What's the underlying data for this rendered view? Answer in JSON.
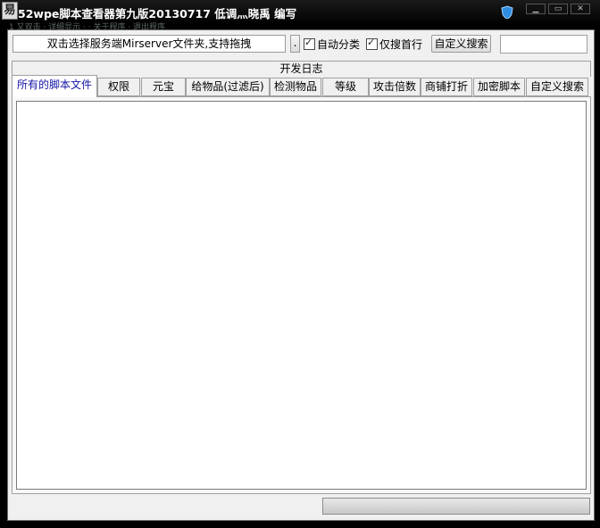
{
  "window": {
    "title": "52wpe脚本查看器第九版20130717  低调灬晓禹 编写",
    "app_icon_glyph": "易",
    "background_menu_text": "1 又双击 · 详细显示 · · 关于程序 · 退出程序"
  },
  "toolbar": {
    "path_button_label": "双击选择服务端Mirserver文件夹,支持拖拽",
    "dot_button_label": ".",
    "auto_classify_label": "自动分类",
    "auto_classify_checked": true,
    "first_line_only_label": "仅搜首行",
    "first_line_only_checked": true,
    "custom_search_button_label": "自定义搜索",
    "search_value": ""
  },
  "tabs_row1": {
    "label": "开发日志"
  },
  "tabs_row2": [
    {
      "label": "所有的脚本文件",
      "active": true
    },
    {
      "label": "权限"
    },
    {
      "label": "元宝"
    },
    {
      "label": "给物品(过滤后)"
    },
    {
      "label": "检测物品"
    },
    {
      "label": "等级"
    },
    {
      "label": "攻击倍数"
    },
    {
      "label": "商铺打折"
    },
    {
      "label": "加密脚本"
    },
    {
      "label": "自定义搜索"
    }
  ],
  "colors": {
    "titlebar": "#000000",
    "active_tab_text": "#1414a8",
    "client_bg": "#f0f0f0"
  }
}
